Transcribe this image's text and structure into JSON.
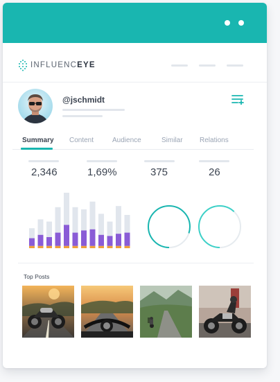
{
  "window": {
    "controls": [
      "dot",
      "dot"
    ]
  },
  "brand": {
    "name_part1": "INFLUENC",
    "name_part2": "EYE",
    "mark_icon": "dotted-eye-logo"
  },
  "profile": {
    "username": "@jschmidt",
    "avatar_icon": "user-avatar",
    "menu_icon": "list-add-icon"
  },
  "tabs": [
    {
      "label": "Summary",
      "active": true
    },
    {
      "label": "Content",
      "active": false
    },
    {
      "label": "Audience",
      "active": false
    },
    {
      "label": "Similar",
      "active": false
    },
    {
      "label": "Relations",
      "active": false
    }
  ],
  "stats": [
    "2,346",
    "1,69%",
    "375",
    "26"
  ],
  "chart_data": {
    "type": "bar",
    "series_colors": {
      "total": "#e1e6ed",
      "primary": "#8a5cd6",
      "secondary": "#f0a03c"
    },
    "bars": [
      {
        "total": 0.36,
        "primary": 0.14,
        "secondary": 0.04
      },
      {
        "total": 0.52,
        "primary": 0.2,
        "secondary": 0.04
      },
      {
        "total": 0.48,
        "primary": 0.16,
        "secondary": 0.04
      },
      {
        "total": 0.74,
        "primary": 0.24,
        "secondary": 0.04
      },
      {
        "total": 1.0,
        "primary": 0.38,
        "secondary": 0.04
      },
      {
        "total": 0.74,
        "primary": 0.24,
        "secondary": 0.04
      },
      {
        "total": 0.7,
        "primary": 0.28,
        "secondary": 0.04
      },
      {
        "total": 0.84,
        "primary": 0.3,
        "secondary": 0.04
      },
      {
        "total": 0.62,
        "primary": 0.2,
        "secondary": 0.04
      },
      {
        "total": 0.48,
        "primary": 0.18,
        "secondary": 0.04
      },
      {
        "total": 0.76,
        "primary": 0.22,
        "secondary": 0.04
      },
      {
        "total": 0.6,
        "primary": 0.24,
        "secondary": 0.04
      }
    ]
  },
  "gauges": [
    {
      "value": 0.8,
      "color": "#19b6b0"
    },
    {
      "value": 0.62,
      "color": "#3dd1c8"
    }
  ],
  "top_posts": {
    "title": "Top Posts",
    "posts": [
      "motorcycle-sunset-photo",
      "handlebar-road-photo",
      "mountain-road-rider-photo",
      "rider-on-motorcycle-photo"
    ]
  },
  "colors": {
    "accent": "#19b6b0",
    "text": "#3b4350",
    "muted": "#9aa4b4"
  }
}
